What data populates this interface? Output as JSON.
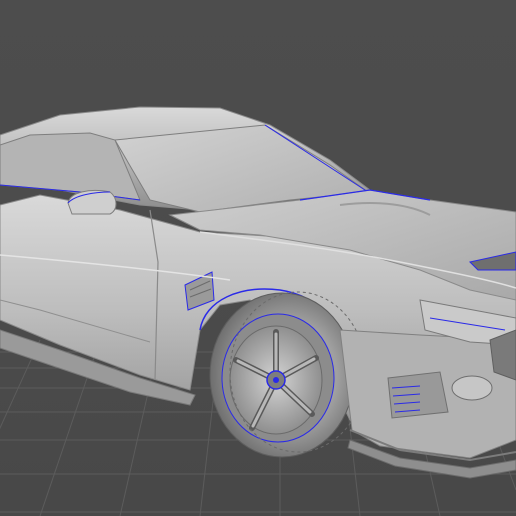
{
  "viewport": {
    "background_color": "#4b4b4b",
    "grid_line_color": "#5c5c5c",
    "model_body_color": "#bdbdbd",
    "edge_highlight_color": "#2a2ae8",
    "subject": "car-3d-model"
  }
}
